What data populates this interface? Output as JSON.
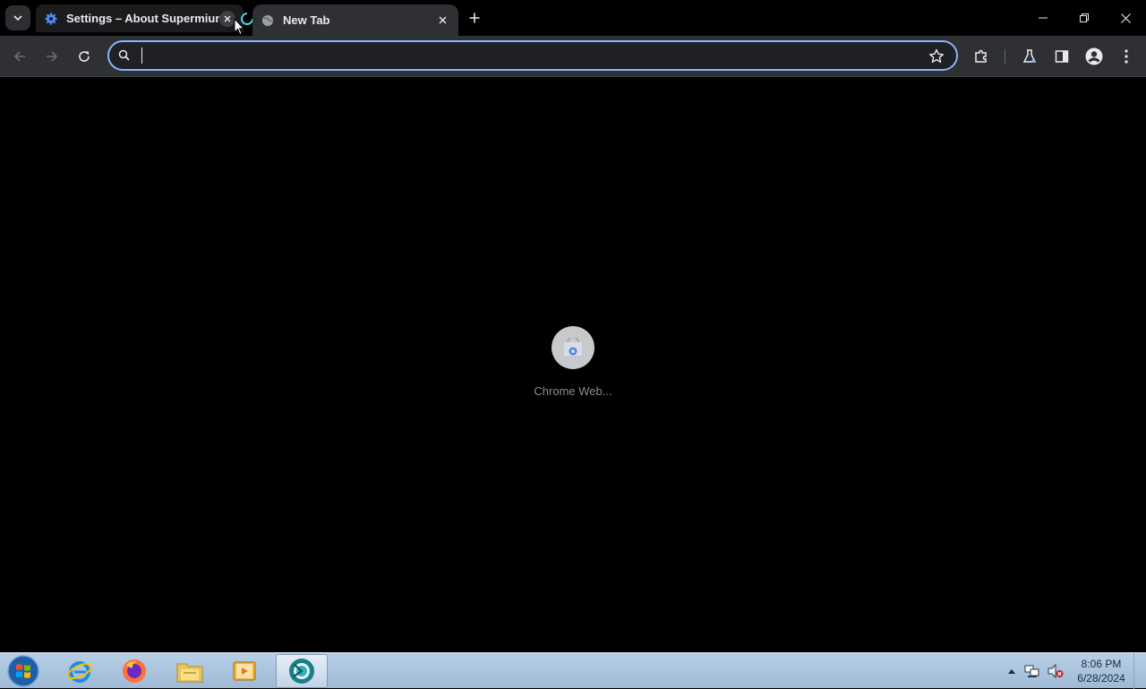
{
  "browser": {
    "tabs": [
      {
        "title": "Settings – About Supermium",
        "favicon": "gear-icon",
        "state": "inactive"
      },
      {
        "title": "New Tab",
        "favicon": "globe-icon",
        "state": "active"
      }
    ],
    "address_bar": {
      "value": "",
      "placeholder": ""
    },
    "accent_color": "#8ab4f8"
  },
  "content": {
    "loading_label": "Chrome Web..."
  },
  "taskbar": {
    "apps": [
      "internet-explorer-icon",
      "firefox-icon",
      "file-explorer-icon",
      "media-player-icon",
      "supermium-icon"
    ],
    "clock": {
      "time": "8:06 PM",
      "date": "6/28/2024"
    }
  }
}
